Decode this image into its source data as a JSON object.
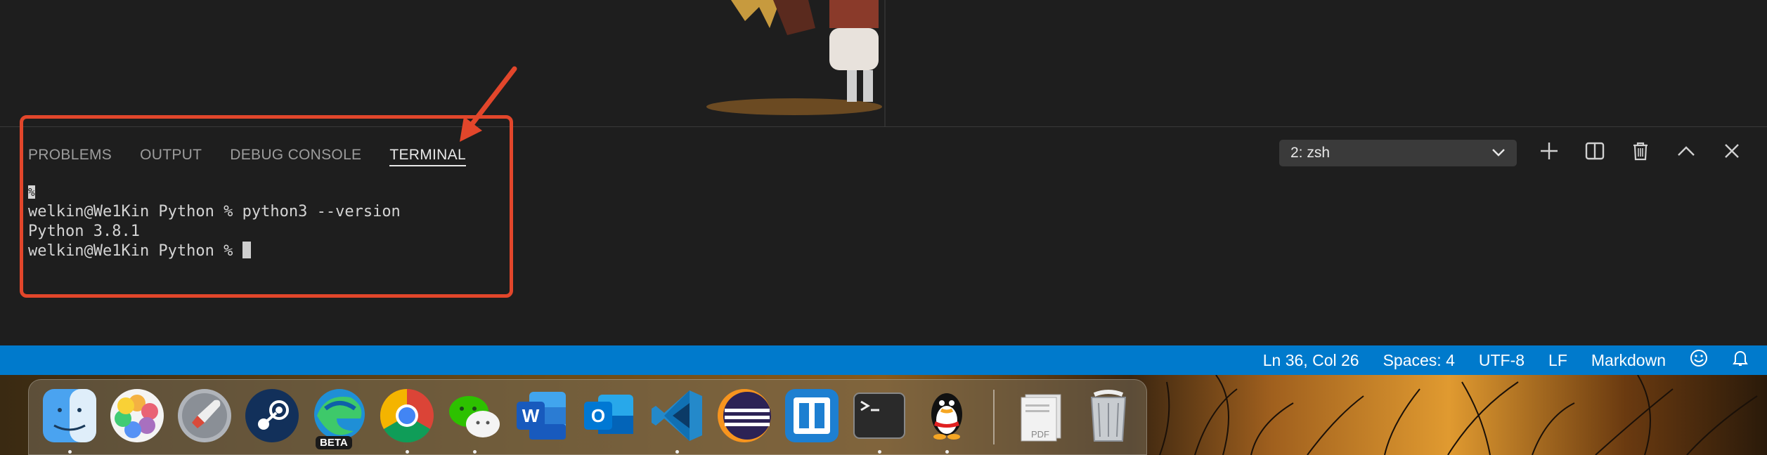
{
  "panel": {
    "tabs": [
      {
        "label": "PROBLEMS",
        "active": false
      },
      {
        "label": "OUTPUT",
        "active": false
      },
      {
        "label": "DEBUG CONSOLE",
        "active": false
      },
      {
        "label": "TERMINAL",
        "active": true
      }
    ],
    "terminal_selector": {
      "value": "2: zsh",
      "icon": "chevron-down-icon"
    },
    "actions": [
      {
        "name": "new-terminal",
        "icon": "plus-icon"
      },
      {
        "name": "split-terminal",
        "icon": "split-icon"
      },
      {
        "name": "kill-terminal",
        "icon": "trash-icon"
      },
      {
        "name": "maximize-panel",
        "icon": "chevron-up-icon"
      },
      {
        "name": "close-panel",
        "icon": "close-icon"
      }
    ]
  },
  "terminal": {
    "lines": [
      "%",
      "welkin@We1Kin Python % python3 --version",
      "Python 3.8.1",
      "welkin@We1Kin Python % "
    ]
  },
  "statusbar": {
    "position": "Ln 36, Col 26",
    "spaces": "Spaces: 4",
    "encoding": "UTF-8",
    "eol": "LF",
    "language": "Markdown",
    "feedback_icon": "smiley-icon",
    "notifications_icon": "bell-icon"
  },
  "dock": {
    "beta_badge": "BETA",
    "pdf_label": "PDF",
    "apps": [
      {
        "name": "Finder",
        "icon": "finder-icon",
        "running": true
      },
      {
        "name": "Photos",
        "icon": "photos-icon",
        "running": false
      },
      {
        "name": "Launchpad",
        "icon": "rocket-icon",
        "running": false
      },
      {
        "name": "Steam",
        "icon": "steam-icon",
        "running": false
      },
      {
        "name": "Edge Beta",
        "icon": "edge-icon",
        "running": false
      },
      {
        "name": "Chrome",
        "icon": "chrome-icon",
        "running": true
      },
      {
        "name": "WeChat",
        "icon": "wechat-icon",
        "running": true
      },
      {
        "name": "Word",
        "icon": "word-icon",
        "running": false
      },
      {
        "name": "Outlook",
        "icon": "outlook-icon",
        "running": false
      },
      {
        "name": "VS Code",
        "icon": "vscode-icon",
        "running": true
      },
      {
        "name": "Eclipse",
        "icon": "eclipse-icon",
        "running": false
      },
      {
        "name": "Mosaic",
        "icon": "mosaic-icon",
        "running": false
      },
      {
        "name": "Terminal",
        "icon": "terminal-icon",
        "running": true
      },
      {
        "name": "QQ",
        "icon": "qq-icon",
        "running": true
      },
      {
        "name": "Documents",
        "icon": "pdf-stack-icon",
        "running": false
      },
      {
        "name": "Trash",
        "icon": "trash-can-icon",
        "running": false
      }
    ]
  },
  "colors": {
    "statusbar": "#007acc",
    "annotation": "#e2462b",
    "panel_bg": "#1e1e1e"
  }
}
